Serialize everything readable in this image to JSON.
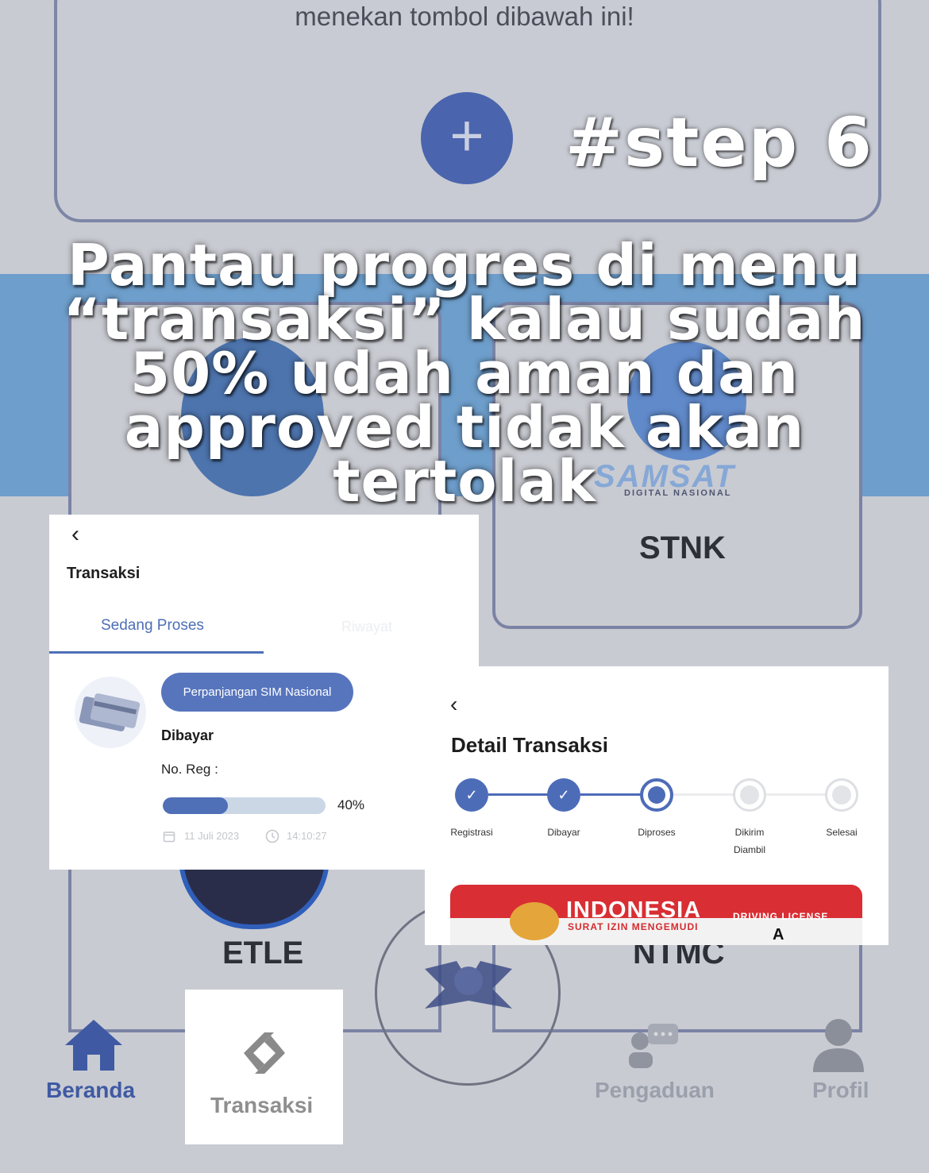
{
  "background_app": {
    "hint_text": "menekan tombol dibawah ini!",
    "add_button_glyph": "+",
    "samsat_logo_text": "SAMSAT",
    "samsat_logo_subtext": "DIGITAL NASIONAL",
    "tiles": {
      "stnk": "STNK",
      "etle": "ETLE",
      "ntmc": "NTMC"
    },
    "bottom_nav": {
      "home": "Beranda",
      "transactions": "Transaksi",
      "complaints": "Pengaduan",
      "profile": "Profil"
    },
    "colors": {
      "brand_blue": "#4a64ad",
      "nav_active": "#3f5aa3",
      "nav_inactive": "#9aa0ab"
    }
  },
  "overlay": {
    "step_label": "#step 6",
    "caption_lines": [
      "Pantau progres di menu",
      "“transaksi” kalau sudah",
      "50% udah aman dan",
      "approved tidak akan",
      "tertolak"
    ]
  },
  "transaksi_screen": {
    "back_glyph": "‹",
    "title": "Transaksi",
    "tabs": [
      "Sedang Proses",
      "Riwayat"
    ],
    "active_tab_index": 0,
    "item": {
      "service": "Perpanjangan SIM Nasional",
      "status": "Dibayar",
      "reg_label": "No. Reg :",
      "progress_percent": 40,
      "progress_label": "40%",
      "date": "11 Juli 2023",
      "time": "14:10:27"
    }
  },
  "detail_screen": {
    "back_glyph": "‹",
    "title": "Detail Transaksi",
    "steps": [
      {
        "label": "Registrasi",
        "state": "done"
      },
      {
        "label": "Dibayar",
        "state": "done"
      },
      {
        "label": "Diproses",
        "state": "current"
      },
      {
        "label": "Dikirim",
        "label2": "Diambil",
        "state": "pending"
      },
      {
        "label": "Selesai",
        "state": "pending"
      }
    ],
    "license_card": {
      "country": "INDONESIA",
      "subtitle": "SURAT IZIN MENGEMUDI",
      "type": "DRIVING LICENSE",
      "class": "A"
    }
  }
}
